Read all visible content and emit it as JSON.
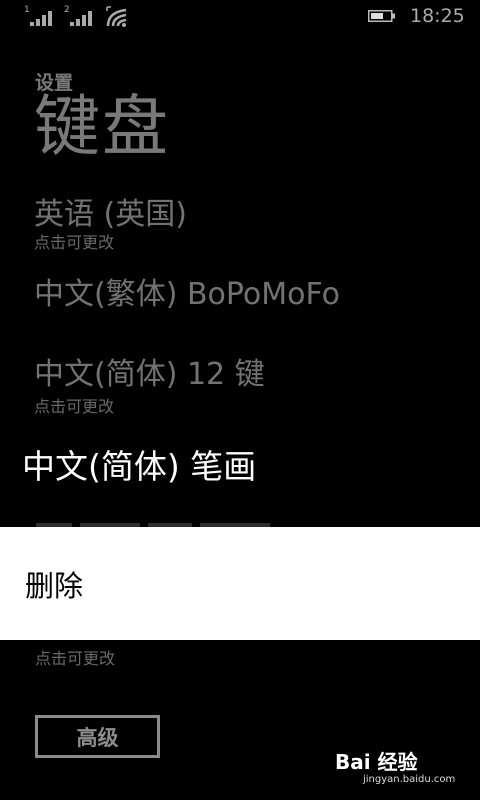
{
  "status": {
    "sim1_label": "1",
    "sim2_label": "2",
    "time": "18:25"
  },
  "header": {
    "breadcrumb": "设置",
    "title": "键盘"
  },
  "keyboards": [
    {
      "label": "英语 (英国)",
      "sub": "点击可更改"
    },
    {
      "label": "中文(繁体) BoPoMoFo"
    },
    {
      "label": "中文(简体) 12 键",
      "sub": "点击可更改"
    }
  ],
  "selected_keyboard": "中文(简体) 笔画",
  "context_menu": {
    "delete_label": "删除"
  },
  "last_item_sub": "点击可更改",
  "advanced_button": "高级",
  "watermark": {
    "brand": "Bai 经验",
    "url": "jingyan.baidu.com"
  }
}
